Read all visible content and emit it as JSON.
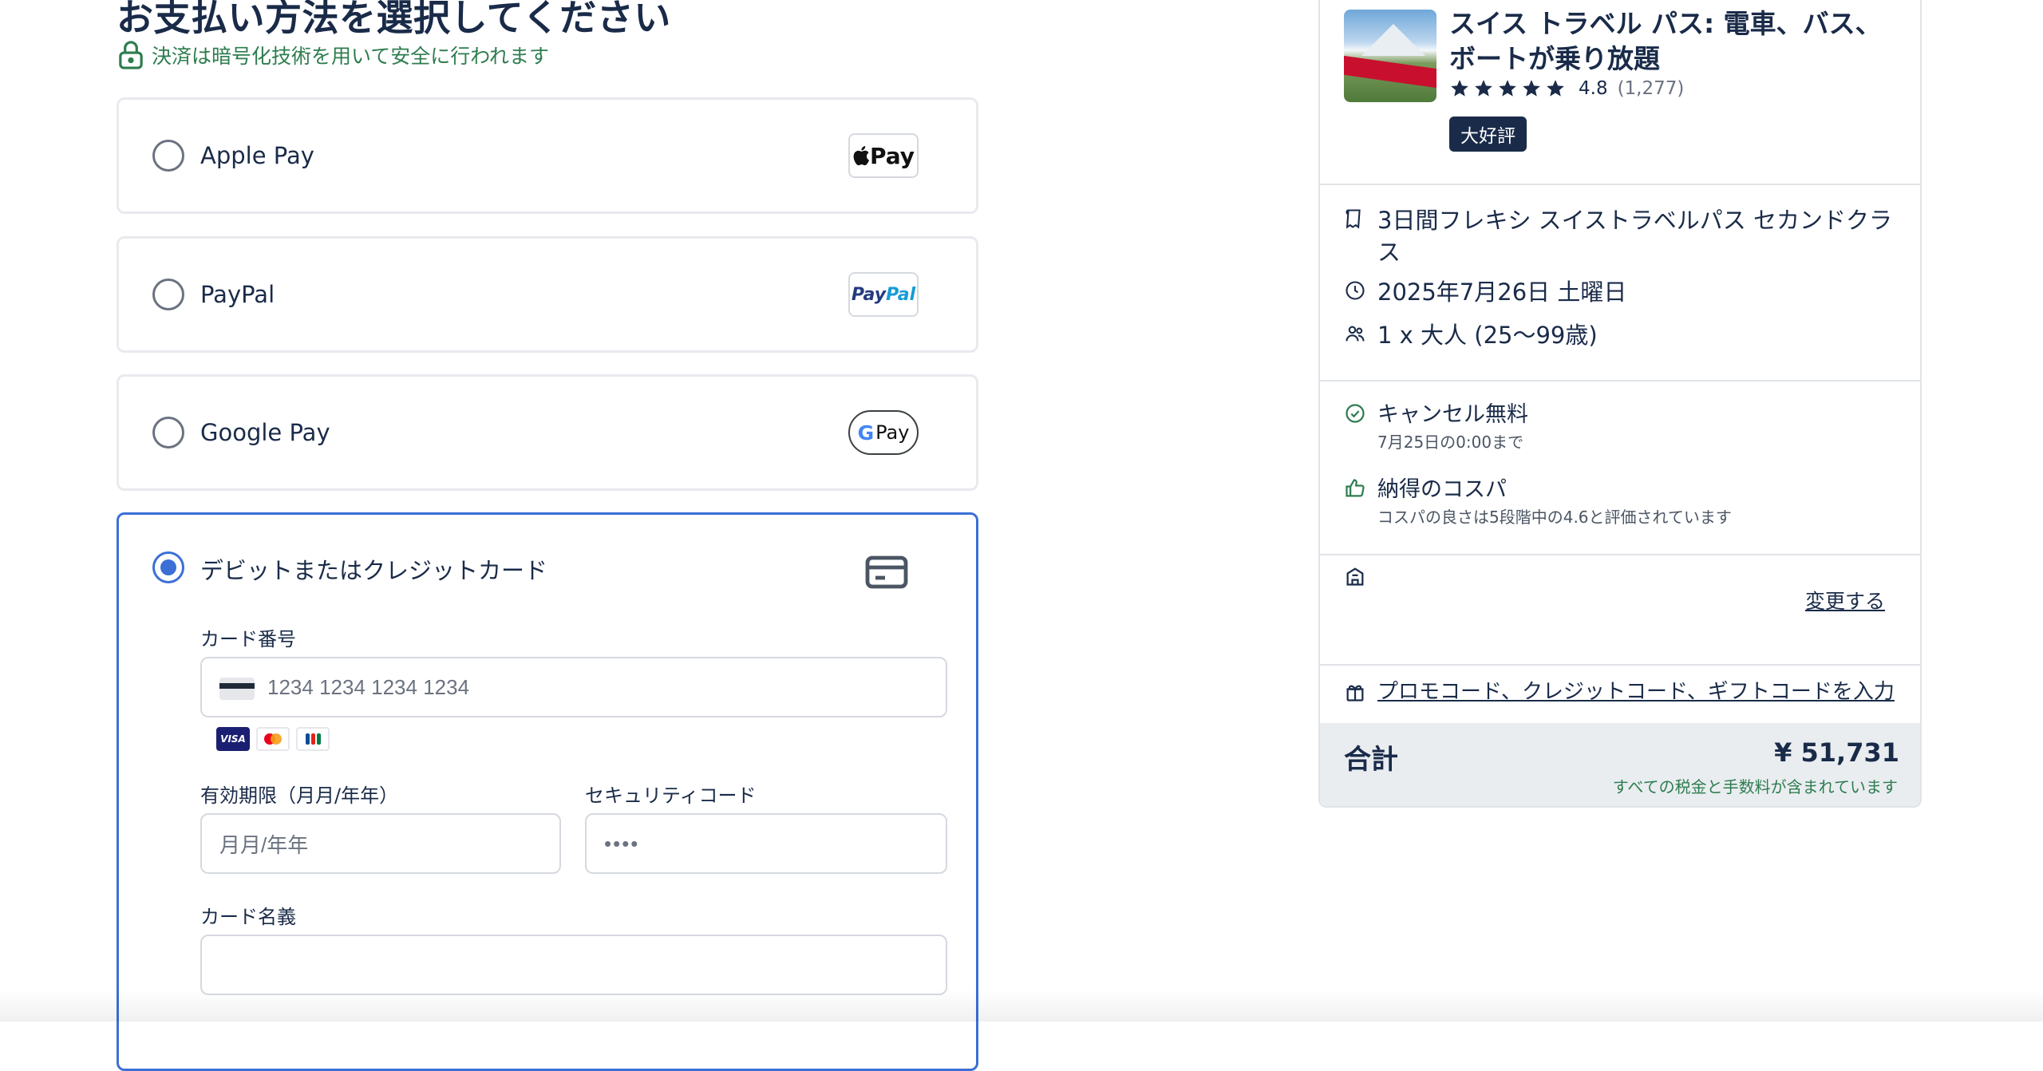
{
  "payment": {
    "title": "お支払い方法を選択してください",
    "secure_note": "決済は暗号化技術を用いて安全に行われます",
    "options": [
      {
        "label": "Apple Pay",
        "badge": "Pay",
        "selected": false
      },
      {
        "label": "PayPal",
        "badge_part1": "Pay",
        "badge_part2": "Pal",
        "selected": false
      },
      {
        "label": "Google Pay",
        "badge_g": "G",
        "badge": "Pay",
        "selected": false
      },
      {
        "label": "デビットまたはクレジットカード",
        "selected": true
      }
    ],
    "card_form": {
      "card_number_label": "カード番号",
      "card_number_placeholder": "1234 1234 1234 1234",
      "card_brands": [
        "VISA",
        "mastercard-icon",
        "jcb-icon"
      ],
      "visa_text": "VISA",
      "expiry_label": "有効期限（月月/年年）",
      "expiry_placeholder": "月月/年年",
      "cvc_label": "セキュリティコード",
      "cvc_placeholder": "••••",
      "name_label": "カード名義",
      "name_value": ""
    }
  },
  "summary": {
    "product_title": "スイス トラベル パス: 電車、バス、ボートが乗り放題",
    "rating": "4.8",
    "review_count": "(1,277)",
    "stars": 5,
    "badge": "大好評",
    "option": "3日間フレキシ スイストラベルパス セカンドクラス",
    "date": "2025年7月26日 土曜日",
    "participants": "1 x 大人 (25〜99歳)",
    "cancellation_title": "キャンセル無料",
    "cancellation_sub": "7月25日の0:00まで",
    "value_title": "納得のコスパ",
    "value_sub": "コスパの良さは5段階中の4.6と評価されています",
    "change_link": "変更する",
    "promo_link": "プロモコード、クレジットコード、ギフトコードを入力",
    "total_label": "合計",
    "total_amount": "¥ 51,731",
    "total_note": "すべての税金と手数料が含まれています"
  },
  "colors": {
    "primary_text": "#1a2b49",
    "accent_blue": "#3b6fd6",
    "success_green": "#2e7d4f",
    "border": "#e8eaee",
    "total_bg": "#e9edf0"
  }
}
